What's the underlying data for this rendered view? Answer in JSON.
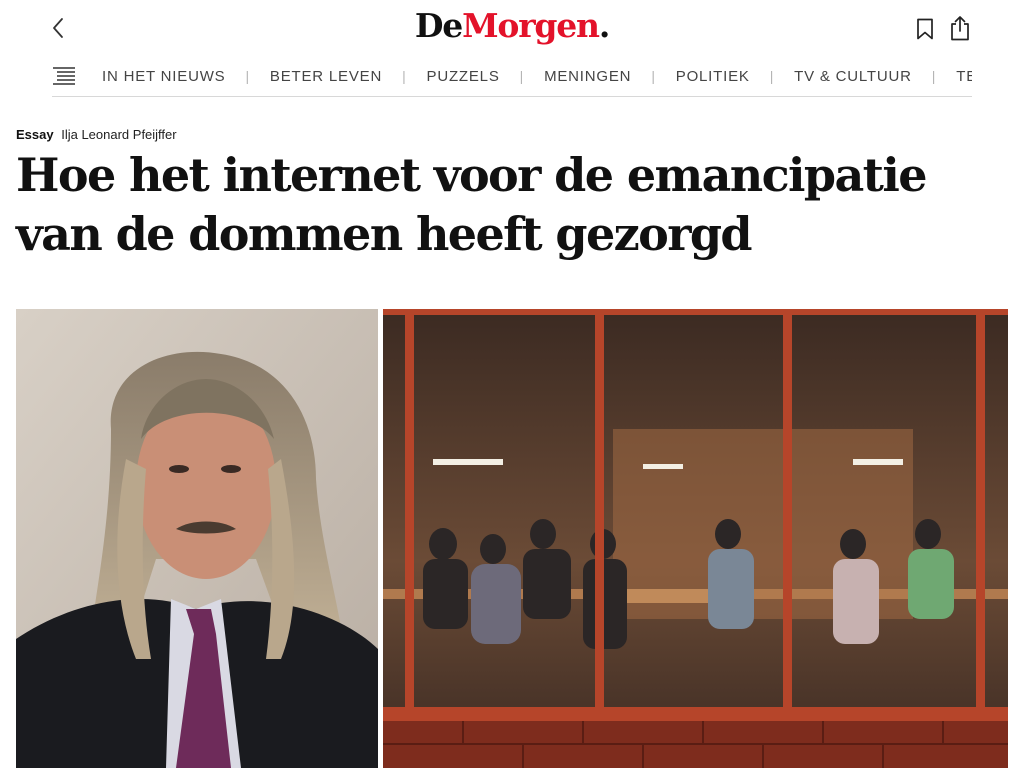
{
  "header": {
    "logo_de": "De",
    "logo_morgen": "Morgen",
    "logo_dot": ".",
    "back_icon": "chevron-left-icon",
    "bookmark_icon": "bookmark-icon",
    "share_icon": "share-icon"
  },
  "nav": {
    "menu_icon": "menu-lines-icon",
    "items": [
      {
        "label": "IN HET NIEUWS"
      },
      {
        "label": "BETER LEVEN"
      },
      {
        "label": "PUZZELS"
      },
      {
        "label": "MENINGEN"
      },
      {
        "label": "POLITIEK"
      },
      {
        "label": "TV & CULTUUR"
      },
      {
        "label": "TECH &"
      }
    ]
  },
  "article": {
    "category": "Essay",
    "author": "Ilja Leonard Pfeijffer",
    "headline": "Hoe het internet voor de emancipatie van de dommen heeft gezorgd"
  },
  "colors": {
    "brand_red": "#e3122a",
    "text": "#111111",
    "nav_text": "#444444",
    "divider": "#d8d8d8"
  }
}
